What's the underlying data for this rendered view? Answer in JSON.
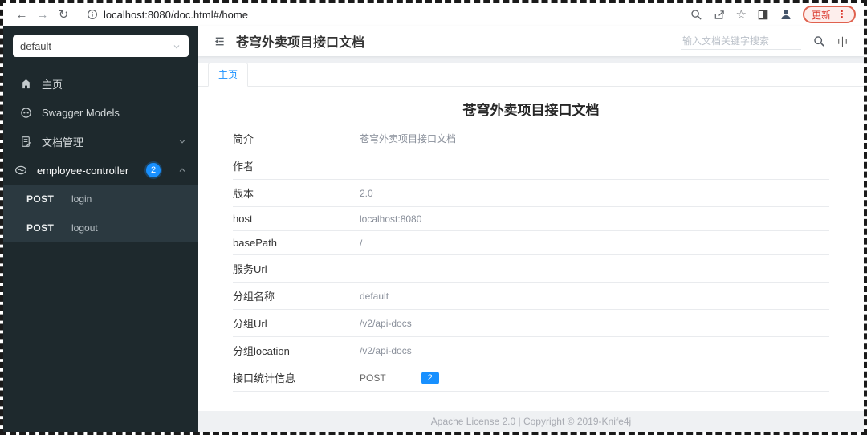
{
  "browser": {
    "url": "localhost:8080/doc.html#/home",
    "update_label": "更新",
    "icons": {
      "back": "←",
      "forward": "→",
      "refresh": "↻",
      "star": "☆",
      "menu_dots": "⋮"
    }
  },
  "sidebar": {
    "group_select": {
      "value": "default"
    },
    "items": [
      {
        "label": "主页",
        "icon": "home-icon"
      },
      {
        "label": "Swagger Models",
        "icon": "models-icon"
      },
      {
        "label": "文档管理",
        "icon": "doc-manage-icon",
        "chevron": "down"
      },
      {
        "label": "employee-controller",
        "icon": "controller-icon",
        "badge": "2",
        "chevron": "up"
      }
    ],
    "submenu": [
      {
        "method": "POST",
        "label": "login"
      },
      {
        "method": "POST",
        "label": "logout"
      }
    ]
  },
  "header": {
    "title": "苍穹外卖项目接口文档",
    "search_placeholder": "输入文档关键字搜索",
    "lang_toggle": "中"
  },
  "tabs": [
    {
      "label": "主页",
      "active": true
    }
  ],
  "content": {
    "title": "苍穹外卖项目接口文档",
    "rows": [
      {
        "label": "简介",
        "value": "苍穹外卖项目接口文档"
      },
      {
        "label": "作者",
        "value": ""
      },
      {
        "label": "版本",
        "value": "2.0"
      },
      {
        "label": "host",
        "value": "localhost:8080"
      },
      {
        "label": "basePath",
        "value": "/"
      },
      {
        "label": "服务Url",
        "value": ""
      },
      {
        "label": "分组名称",
        "value": "default"
      },
      {
        "label": "分组Url",
        "value": "/v2/api-docs"
      },
      {
        "label": "分组location",
        "value": "/v2/api-docs"
      },
      {
        "label": "接口统计信息",
        "value": "POST",
        "badge": "2"
      }
    ]
  },
  "footer": {
    "text": "Apache License 2.0 | Copyright © 2019-Knife4j"
  },
  "colors": {
    "accent": "#1890ff",
    "sidebar_bg": "#1e292d",
    "submenu_bg": "#2b3940",
    "update_red": "#d93025"
  }
}
